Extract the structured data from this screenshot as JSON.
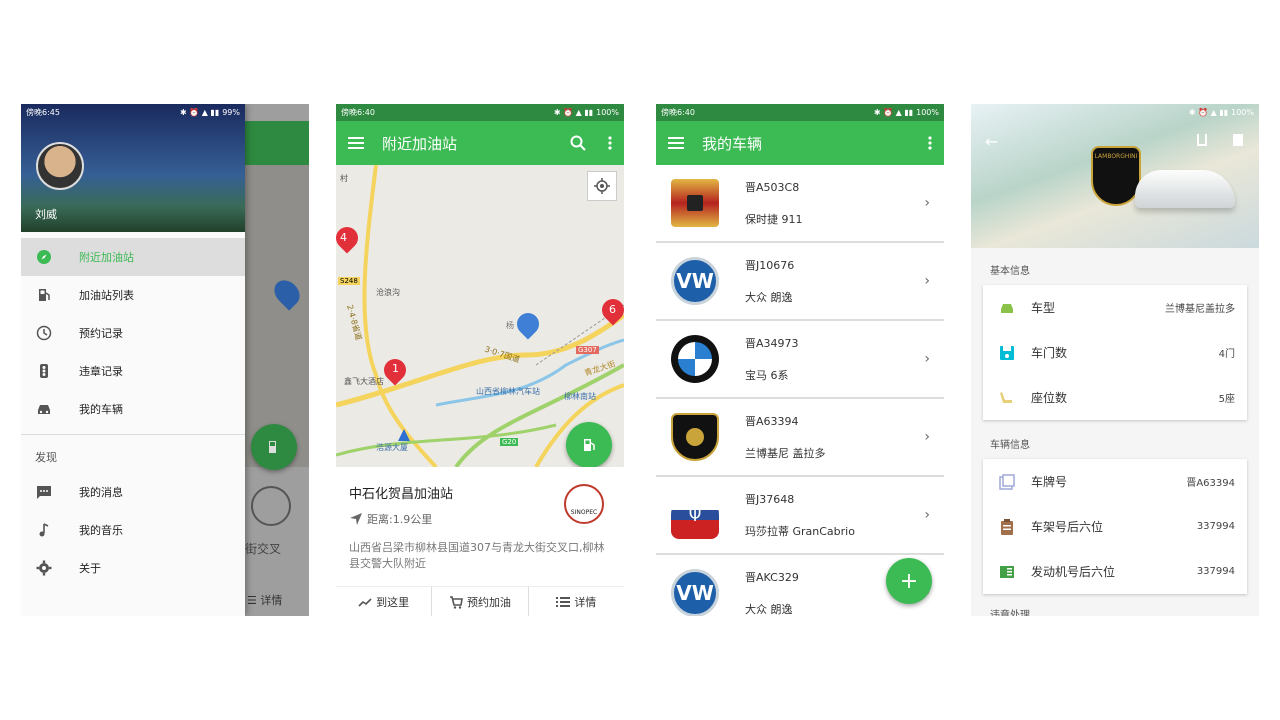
{
  "phone1": {
    "status": {
      "time": "傍晚6:45",
      "battery": "99%"
    },
    "user": "刘威",
    "menu": [
      {
        "label": "附近加油站",
        "icon": "compass-icon"
      },
      {
        "label": "加油站列表",
        "icon": "gas-pump-icon"
      },
      {
        "label": "预约记录",
        "icon": "clock-icon"
      },
      {
        "label": "违章记录",
        "icon": "traffic-light-icon"
      },
      {
        "label": "我的车辆",
        "icon": "car-icon"
      }
    ],
    "section": "发现",
    "menu2": [
      {
        "label": "我的消息",
        "icon": "message-icon"
      },
      {
        "label": "我的音乐",
        "icon": "music-icon"
      },
      {
        "label": "关于",
        "icon": "settings-icon"
      }
    ],
    "behind_text": "街交叉",
    "behind_detail": "详情"
  },
  "phone2": {
    "status": {
      "time": "傍晚6:40",
      "battery": "100%"
    },
    "title": "附近加油站",
    "map_labels": {
      "road1": "S248",
      "road2": "G307",
      "road3": "G20",
      "place1": "沧浪沟",
      "place2": "鑫飞大酒店",
      "place3": "山西省柳林汽车站",
      "place4": "柳林南站",
      "place5": "浩源大厦",
      "place6": "村",
      "place7": "杨",
      "road4": "青龙大街",
      "road5": "3·0·7国道",
      "road6": "2·4·8省道"
    },
    "markers": [
      "4",
      "1",
      "6"
    ],
    "station_name": "中石化贺昌加油站",
    "distance": "距离:1.9公里",
    "address": "山西省吕梁市柳林县国道307与青龙大街交叉口,柳林县交警大队附近",
    "actions": [
      "到这里",
      "预约加油",
      "详情"
    ],
    "logo_text": "SINOPEC"
  },
  "phone3": {
    "status": {
      "time": "傍晚6:40",
      "battery": "100%"
    },
    "title": "我的车辆",
    "cars": [
      {
        "plate": "晋A503C8",
        "model": "保时捷 911",
        "brand": "porsche-logo"
      },
      {
        "plate": "晋J10676",
        "model": "大众 朗逸",
        "brand": "vw-logo"
      },
      {
        "plate": "晋A34973",
        "model": "宝马 6系",
        "brand": "bmw-logo"
      },
      {
        "plate": "晋A63394",
        "model": "兰博基尼 盖拉多",
        "brand": "lamborghini-logo"
      },
      {
        "plate": "晋J37648",
        "model": "玛莎拉蒂 GranCabrio",
        "brand": "maserati-logo"
      },
      {
        "plate": "晋AKC329",
        "model": "大众 朗逸",
        "brand": "vw-logo"
      }
    ],
    "fab": "+"
  },
  "phone4": {
    "status": {
      "battery": "100%"
    },
    "section1": "基本信息",
    "basic": [
      {
        "label": "车型",
        "value": "兰博基尼盖拉多",
        "color": "#8bc34a"
      },
      {
        "label": "车门数",
        "value": "4门",
        "color": "#00bcd4"
      },
      {
        "label": "座位数",
        "value": "5座",
        "color": "#e6d07a"
      }
    ],
    "section2": "车辆信息",
    "vehicle": [
      {
        "label": "车牌号",
        "value": "晋A63394",
        "color": "#9fa8da"
      },
      {
        "label": "车架号后六位",
        "value": "337994",
        "color": "#a1704a"
      },
      {
        "label": "发动机号后六位",
        "value": "337994",
        "color": "#43a047"
      }
    ],
    "section3": "违章处理",
    "brand_text": "LAMBORGHINI"
  }
}
